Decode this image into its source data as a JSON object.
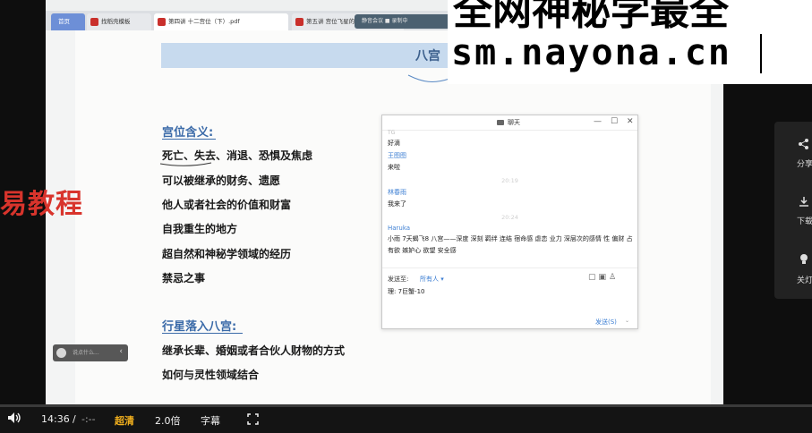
{
  "browser": {
    "tabs": [
      {
        "label": "首页"
      },
      {
        "label": "找稻壳模板"
      },
      {
        "label": "第四讲 十二宫位（下）.pdf"
      },
      {
        "label": "第五讲 宫位飞星的应用.pdf"
      }
    ],
    "add_tab": "+",
    "recording_bar": "静音会议   ■ 录制中"
  },
  "slide": {
    "title": "八宫",
    "section1_title": "宫位含义:",
    "section1_items": [
      "死亡、失去、消退、恐惧及焦虑",
      "可以被继承的财务、遗愿",
      "他人或者社会的价值和财富",
      "自我重生的地方",
      "超自然和神秘学领域的经历",
      "禁忌之事"
    ],
    "section2_title": "行星落入八宫:",
    "section2_items": [
      "继承长辈、婚姻或者合伙人财物的方式",
      "如何与灵性领域结合"
    ]
  },
  "watermark": "易教程",
  "comment_pill": {
    "placeholder": "说点什么...",
    "chevron": "‹"
  },
  "chat": {
    "title": "聊天",
    "window_buttons": {
      "minimize": "—",
      "maximize": "☐",
      "close": "✕"
    },
    "messages": [
      {
        "kind": "user",
        "text": "TG"
      },
      {
        "kind": "text",
        "text": "好滴"
      },
      {
        "kind": "user",
        "text": "王图图"
      },
      {
        "kind": "text",
        "text": "来啦"
      },
      {
        "kind": "stamp",
        "text": "20:19"
      },
      {
        "kind": "user",
        "text": "林春雨"
      },
      {
        "kind": "text",
        "text": "我来了"
      },
      {
        "kind": "stamp",
        "text": "20:24"
      },
      {
        "kind": "user",
        "text": "Haruka"
      },
      {
        "kind": "text",
        "text": "小雨 7天蝎飞8 八宫——深度 深刻 羁绊 连结 宿命感 虐恋 业力 深层次的感情 性 偏财 占有欲 嫉妒心 欲望 安全感"
      }
    ],
    "send_to_label": "发送至:",
    "send_to_value": "所有人 ▾",
    "input_value": "理: 7巨蟹-10",
    "send_button": "发送(S)",
    "send_arrow": "⌄"
  },
  "banner": {
    "line1": "全网神秘学最全",
    "line2": "sm.nayona.cn"
  },
  "side_panel": {
    "items": [
      {
        "icon": "share-icon",
        "label": "分享"
      },
      {
        "icon": "download-icon",
        "label": "下载"
      },
      {
        "icon": "lightbulb-icon",
        "label": "关灯"
      }
    ]
  },
  "player": {
    "current_time": "14:36",
    "separator": "/",
    "duration": "-:--",
    "quality": "超清",
    "speed": "2.0倍",
    "subtitles": "字幕",
    "progress_fraction": 0.0,
    "accent_color": "#2c86e8",
    "quality_color": "#f2b01e"
  }
}
